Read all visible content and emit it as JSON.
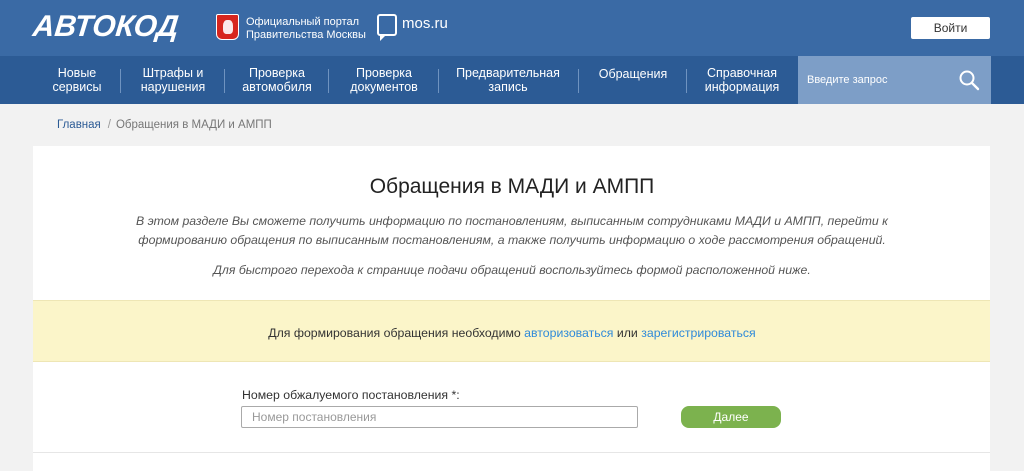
{
  "header": {
    "logo": "АВТОКОД",
    "portal_line1": "Официальный портал",
    "portal_line2": "Правительства Москвы",
    "mosru": "mos.ru",
    "login_label": "Войти"
  },
  "nav": {
    "items": [
      {
        "line1": "Новые",
        "line2": "сервисы"
      },
      {
        "line1": "Штрафы и",
        "line2": "нарушения"
      },
      {
        "line1": "Проверка",
        "line2": "автомобиля"
      },
      {
        "line1": "Проверка",
        "line2": "документов"
      },
      {
        "line1": "Предварительная",
        "line2": "запись"
      },
      {
        "line1": "Обращения",
        "line2": ""
      },
      {
        "line1": "Справочная",
        "line2": "информация"
      }
    ],
    "search_placeholder": "Введите запрос"
  },
  "breadcrumb": {
    "home": "Главная",
    "separator": "/",
    "current": "Обращения в МАДИ и АМПП"
  },
  "main": {
    "title": "Обращения в МАДИ и АМПП",
    "description_line1": "В этом разделе Вы сможете получить информацию по постановлениям, выписанным сотрудниками МАДИ и АМПП, перейти к",
    "description_line2": "формированию обращения по выписанным постановлениям, а также получить информацию о ходе рассмотрения обращений.",
    "description2": "Для быстрого перехода к странице подачи обращений воспользуйтесь формой расположенной ниже.",
    "notice_prefix": "Для формирования обращения необходимо ",
    "notice_link1": "авторизоваться",
    "notice_middle": " или ",
    "notice_link2": "зарегистрироваться",
    "field_label": "Номер обжалуемого постановления *:",
    "field_placeholder": "Номер постановления",
    "next_label": "Далее"
  },
  "colors": {
    "header_bg": "#3a6aa5",
    "nav_bg": "#2c5b95",
    "search_bg": "#7d9ec7",
    "notice_bg": "#fbf5c9",
    "link": "#2f8ad9",
    "button_green": "#7cb24e"
  }
}
